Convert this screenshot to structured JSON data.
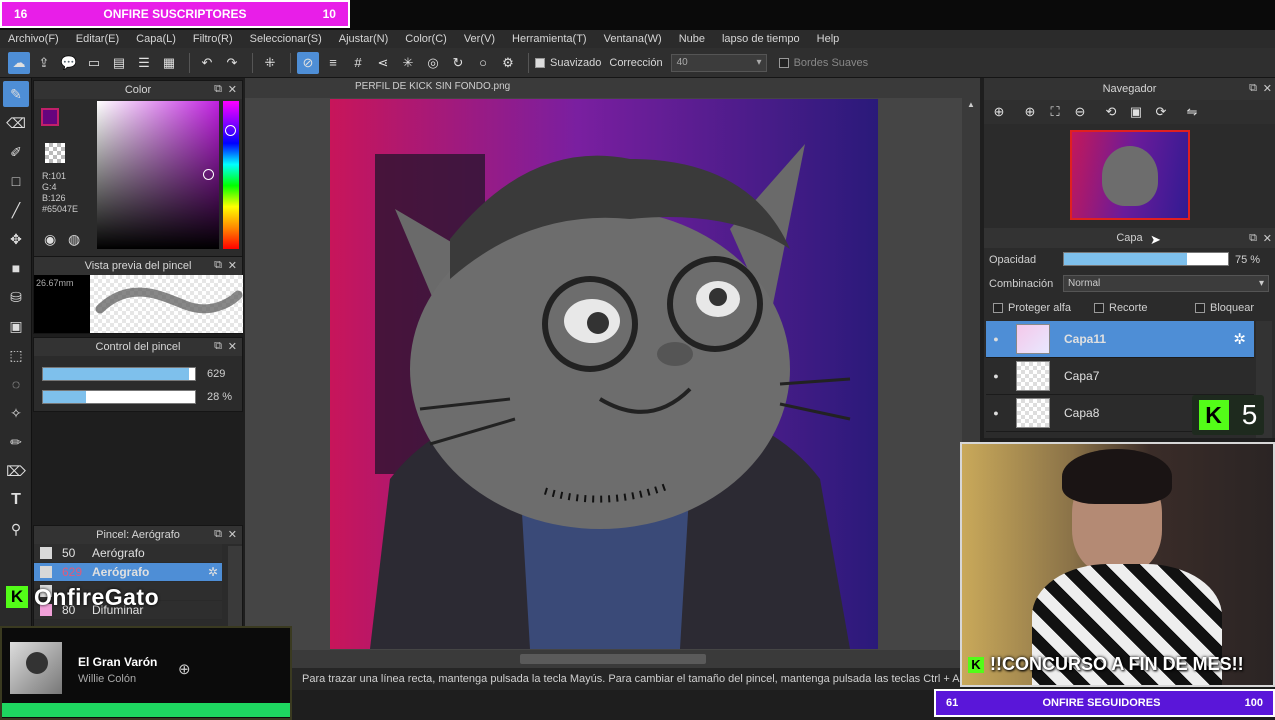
{
  "overlay": {
    "top_goal": {
      "left": "16",
      "label": "ONFIRE SUSCRIPTORES",
      "right": "10"
    },
    "bottom_goal": {
      "left": "61",
      "label": "ONFIRE SEGUIDORES",
      "right": "100"
    },
    "contest": "!!CONCURSO A FIN DE MES!!",
    "kick_count": "5",
    "streamer_name": "OnfireGato",
    "now_playing": {
      "title": "El Gran Varón",
      "artist": "Willie Colón"
    }
  },
  "menu": [
    "Archivo(F)",
    "Editar(E)",
    "Capa(L)",
    "Filtro(R)",
    "Seleccionar(S)",
    "Ajustar(N)",
    "Color(C)",
    "Ver(V)",
    "Herramienta(T)",
    "Ventana(W)",
    "Nube",
    "lapso de tiempo",
    "Help"
  ],
  "toolbar": {
    "smoothing_label": "Suavizado",
    "correction_label": "Corrección",
    "correction_value": "40",
    "soft_edges_label": "Bordes Suaves"
  },
  "color_panel": {
    "title": "Color",
    "r": "R:101",
    "g": "G:4",
    "b": "B:126",
    "hex": "#65047E",
    "color": "#65047E"
  },
  "brush_preview": {
    "title": "Vista previa del pincel",
    "size": "26.67mm"
  },
  "brush_control": {
    "title": "Control del pincel",
    "size_value": "629",
    "size_fill": 0.96,
    "opacity_value": "28 %",
    "opacity_fill": 0.28
  },
  "brush_list": {
    "title": "Pincel: Aerógrafo",
    "rows": [
      {
        "num": "50",
        "name": "Aerógrafo",
        "selected": false
      },
      {
        "num": "629",
        "name": "Aerógrafo",
        "selected": true
      },
      {
        "num": "",
        "name": "",
        "selected": false
      },
      {
        "num": "80",
        "name": "Difuminar",
        "selected": false
      }
    ]
  },
  "document": {
    "tab_title": "PERFIL DE KICK SIN FONDO.png"
  },
  "status": "Para trazar una línea recta, mantenga pulsada la tecla Mayús. Para cambiar el tamaño del pincel, mantenga pulsada las teclas Ctrl + A",
  "navigator": {
    "title": "Navegador"
  },
  "layers": {
    "title": "Capa",
    "opacity_label": "Opacidad",
    "opacity_value": "75 %",
    "opacity_fill": 0.75,
    "blend_label": "Combinación",
    "blend_value": "Normal",
    "protect_alpha": "Proteger alfa",
    "clip": "Recorte",
    "lock": "Bloquear",
    "items": [
      {
        "name": "Capa11",
        "selected": true
      },
      {
        "name": "Capa7",
        "selected": false
      },
      {
        "name": "Capa8",
        "selected": false
      }
    ]
  },
  "colors": {
    "accent": "#4e8ed6",
    "magenta": "#e81ee8",
    "purple": "#5a16d9",
    "kick_green": "#53fc18"
  }
}
